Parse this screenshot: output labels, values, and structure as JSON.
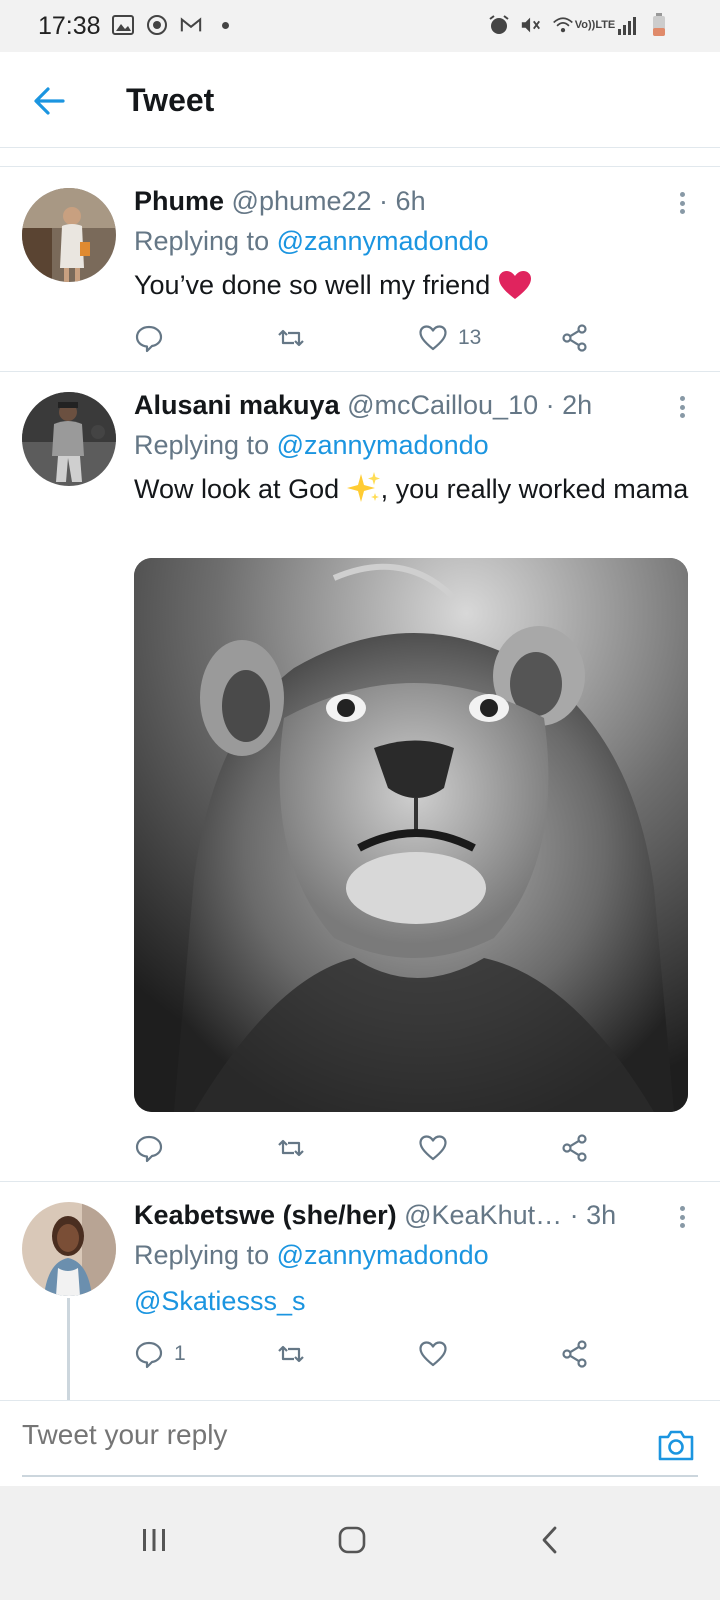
{
  "status_bar": {
    "time": "17:38",
    "left_icons": [
      "gallery-icon",
      "sync-icon",
      "mail-icon",
      "dot-icon"
    ],
    "right_icons": [
      "alarm-icon",
      "mute-icon",
      "wifi-icon",
      "volte-icon",
      "signal-icon",
      "battery-icon"
    ],
    "volte_top": "Vo))",
    "volte_bottom": "LTE",
    "battery_color": "#e08a6a"
  },
  "header": {
    "title": "Tweet",
    "back_icon": "arrow-left-icon"
  },
  "colors": {
    "accent": "#1b95e0",
    "like_red": "#e0245e",
    "muted": "#657786"
  },
  "tweets": [
    {
      "name": "Phume",
      "handle": "@phume22",
      "sep": " · ",
      "time": "6h",
      "replying_prefix": "Replying to ",
      "replying_to": "@zannymadondo",
      "text": "You’ve done so well my friend",
      "emoji": "❤️",
      "reply_count": "",
      "retweet_count": "",
      "like_count": "13"
    },
    {
      "name": "Alusani makuya",
      "handle": "@mcCaillou_10",
      "sep": " · ",
      "time": "2h",
      "replying_prefix": "Replying to ",
      "replying_to": "@zannymadondo",
      "text_before": "Wow look at God ",
      "emoji": "✨",
      "text_after": ", you really worked mama",
      "reply_count": "",
      "retweet_count": "",
      "like_count": "",
      "media_alt": "lion photo"
    },
    {
      "name": "Keabetswe (she/her)",
      "handle": "@KeaKhut…",
      "sep": " · ",
      "time": "3h",
      "replying_prefix": "Replying to ",
      "replying_to": "@zannymadondo",
      "text_mention": "@Skatiesss_s",
      "reply_count": "1",
      "retweet_count": "",
      "like_count": ""
    }
  ],
  "reply_bar": {
    "placeholder": "Tweet your reply",
    "camera_icon": "camera-icon"
  },
  "nav_bar": {
    "icons": [
      "recents-icon",
      "home-icon",
      "back-icon"
    ]
  }
}
